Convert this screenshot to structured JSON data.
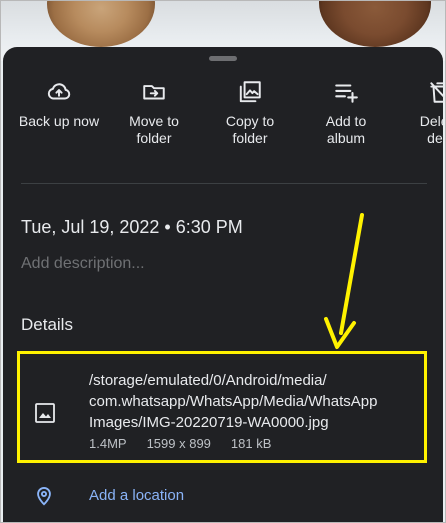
{
  "colors": {
    "sheet_bg": "#202124",
    "text": "#e8eaed",
    "muted": "#6f7174",
    "link": "#8ab4f8",
    "highlight": "#fff200"
  },
  "actions": [
    {
      "icon": "cloud-upload-icon",
      "label": "Back up now"
    },
    {
      "icon": "move-to-folder-icon",
      "label": "Move to\nfolder"
    },
    {
      "icon": "copy-to-folder-icon",
      "label": "Copy to\nfolder"
    },
    {
      "icon": "add-to-album-icon",
      "label": "Add to\nalbum"
    },
    {
      "icon": "delete-icon",
      "label": "Delete\ndevi"
    }
  ],
  "datetime": "Tue, Jul 19, 2022 • 6:30 PM",
  "description_placeholder": "Add description...",
  "details_heading": "Details",
  "file": {
    "icon": "image-icon",
    "path_lines": [
      "/storage/emulated/0/Android/media/",
      "com.whatsapp/WhatsApp/Media/WhatsApp",
      "Images/IMG-20220719-WA0000.jpg"
    ],
    "megapixels": "1.4MP",
    "dimensions": "1599 x 899",
    "size": "181 kB"
  },
  "location": {
    "icon": "location-pin-icon",
    "label": "Add a location"
  }
}
